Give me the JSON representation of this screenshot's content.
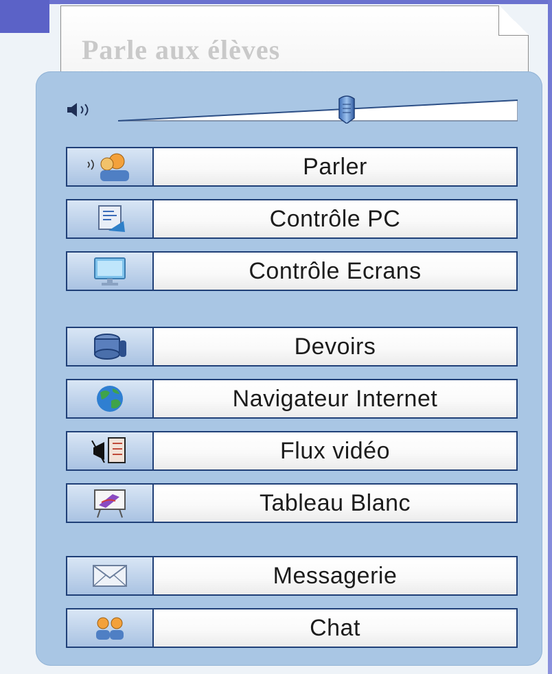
{
  "note": {
    "text": "Parle aux élèves"
  },
  "volume": {
    "icon": "speaker-icon",
    "level_fraction": 0.7
  },
  "buttons": [
    {
      "label": "Parler",
      "icon": "talk-people-icon"
    },
    {
      "label": "Contrôle PC",
      "icon": "pc-control-icon"
    },
    {
      "label": "Contrôle Ecrans",
      "icon": "monitor-icon"
    },
    {
      "label": "Devoirs",
      "icon": "homework-stack-icon"
    },
    {
      "label": "Navigateur Internet",
      "icon": "globe-icon"
    },
    {
      "label": "Flux vidéo",
      "icon": "video-stream-icon"
    },
    {
      "label": "Tableau Blanc",
      "icon": "whiteboard-icon"
    },
    {
      "label": "Messagerie",
      "icon": "envelope-icon"
    },
    {
      "label": "Chat",
      "icon": "chat-people-icon"
    }
  ],
  "colors": {
    "panel": "#a9c6e4",
    "button_border": "#1f3f77",
    "accent": "#5b62c7"
  }
}
